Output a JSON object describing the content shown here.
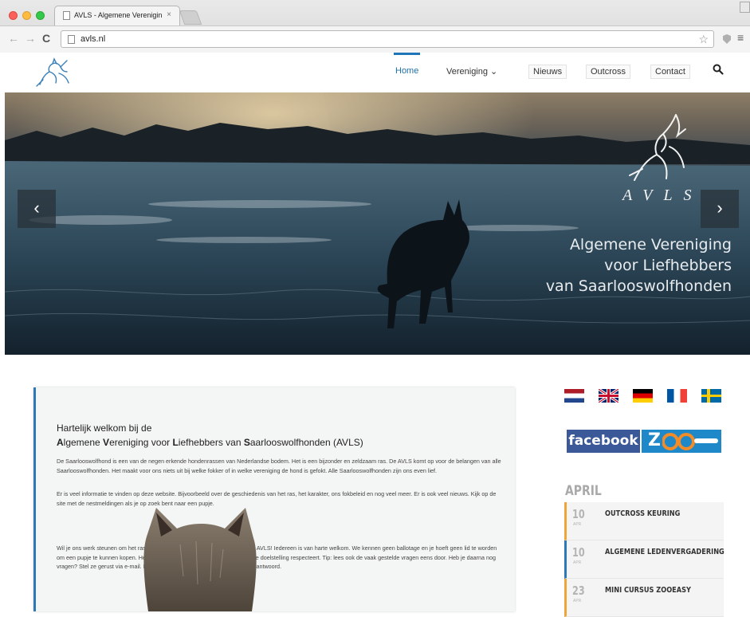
{
  "browser": {
    "tab_title": "AVLS - Algemene Vereniging",
    "tab_close": "×",
    "url": "avls.nl",
    "back_glyph": "←",
    "forward_glyph": "→",
    "reload_glyph": "C",
    "star_glyph": "☆",
    "menu_glyph": "≡"
  },
  "nav": {
    "items": [
      {
        "label": "Home",
        "active": true
      },
      {
        "label": "Vereniging ⌄"
      },
      {
        "label": "Nieuws"
      },
      {
        "label": "Outcross"
      },
      {
        "label": "Contact"
      }
    ],
    "search_icon": "search-icon"
  },
  "hero": {
    "prev_glyph": "‹",
    "next_glyph": "›",
    "logo_text": "AVLS",
    "slogan": [
      "Algemene Vereniging",
      "voor Liefhebbers",
      "van Saarlooswolfhonden"
    ]
  },
  "welcome": {
    "heading_line1": "Hartelijk welkom bij de",
    "heading_line2": "Algemene Vereniging voor Liefhebbers van Saarlooswolfhonden (AVLS)",
    "heading_caps": [
      "A",
      "V",
      "L",
      "S"
    ],
    "heading_rest": [
      "lgemene ",
      "ereniging voor ",
      "iefhebbers van ",
      "aarlooswolfhonden (AVLS)"
    ],
    "paragraphs": [
      "De Saarlooswolfhond is een van de negen erkende hondenrassen van Nederlandse bodem. Het is een bijzonder en zeldzaam ras. De AVLS komt op voor de belangen van alle Saarlooswolfhonden. Het maakt voor ons niets uit bij welke fokker of in welke vereniging de hond is gefokt. Alle Saarlooswolfhonden zijn ons even lief.",
      "Er is veel informatie te vinden op deze website. Bijvoorbeeld over de geschiedenis van het ras, het karakter, ons fokbeleid en nog veel meer. Er is ook veel nieuws. Kijk op de site met de nestmeldingen als je op zoek bent naar een pupje.",
      "Wil je ons werk steunen om het ras gezond te behouden? Word dan lid van de AVLS! Iedereen is van harte welkom. We kennen geen ballotage en je hoeft geen lid te worden om een pupje te kunnen kopen. Het enige wat we verwachten is dat je als lid de doelstelling respecteert. Tip: lees ook de vaak gestelde vragen eens door. Heb je daarna nog vragen? Stel ze gerust via e-mail. Elke vraag, opmerking of suggestie wordt beantwoord."
    ]
  },
  "sidebar": {
    "flags": [
      "NL",
      "UK",
      "DE",
      "FR",
      "SE"
    ],
    "facebook_label": "facebook",
    "zooeasy_label": "Z",
    "month": "APRIL",
    "events": [
      {
        "day": "10",
        "mon": "APR",
        "title": "OUTCROSS KEURING",
        "accent": "#f0a53a"
      },
      {
        "day": "10",
        "mon": "APR",
        "title": "ALGEMENE LEDENVERGADERING",
        "accent": "#2e78b8"
      },
      {
        "day": "23",
        "mon": "APR",
        "title": "MINI CURSUS ZOOEASY",
        "accent": "#f0a53a"
      }
    ]
  },
  "colors": {
    "brand_blue": "#1e75b8",
    "accent_orange": "#f0a53a",
    "facebook": "#3b5998"
  }
}
